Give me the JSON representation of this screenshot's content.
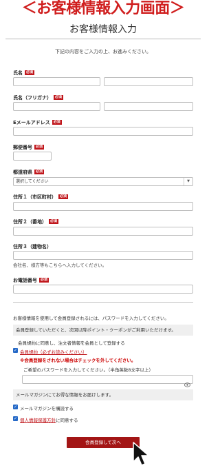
{
  "banner": "＜お客様情報入力画面＞",
  "page_title": "お客様情報入力",
  "intro": "下記の内容をご入力の上、お進みください。",
  "required_badge": "必須",
  "fields": {
    "name_label": "氏名",
    "kana_label": "氏名（フリガナ）",
    "email_label": "Eメールアドレス",
    "zip_label": "郵便番号",
    "pref_label": "都道府県",
    "pref_value": "選択してください",
    "address1_label": "住所１（市区町村）",
    "address2_label": "住所２（番地）",
    "address3_label": "住所３（建物名）",
    "address3_note": "会社名、様方等もこちらへ入力してください。",
    "phone_label": "お電話番号"
  },
  "membership": {
    "info": "お客様情報を使用して会員登録されるには、パスワードを入力してください。",
    "benefit": "会員登録していただくと、次回以降ポイント・クーポンがご利用いただけます。",
    "agree_text": "会員規約に同意し、注文者情報を会員として登録する",
    "terms_link": "会員規約（必ずお読みください）",
    "warning": "※会員登録をされない場合はチェックを外してください。",
    "password_prompt": "ご希望のパスワードを入力してください。（半角英数8文字以上）",
    "newsletter_info": "メールマガジンにてお得な情報をお届けします。",
    "newsletter_label": "メールマガジンを購読する",
    "privacy_link": "個人情報保護方針",
    "privacy_suffix": "に同意する"
  },
  "submit_label": "会員登録して次へ",
  "colors": {
    "accent": "#d01e1e",
    "button": "#a31515",
    "checkbox": "#2569c7"
  }
}
